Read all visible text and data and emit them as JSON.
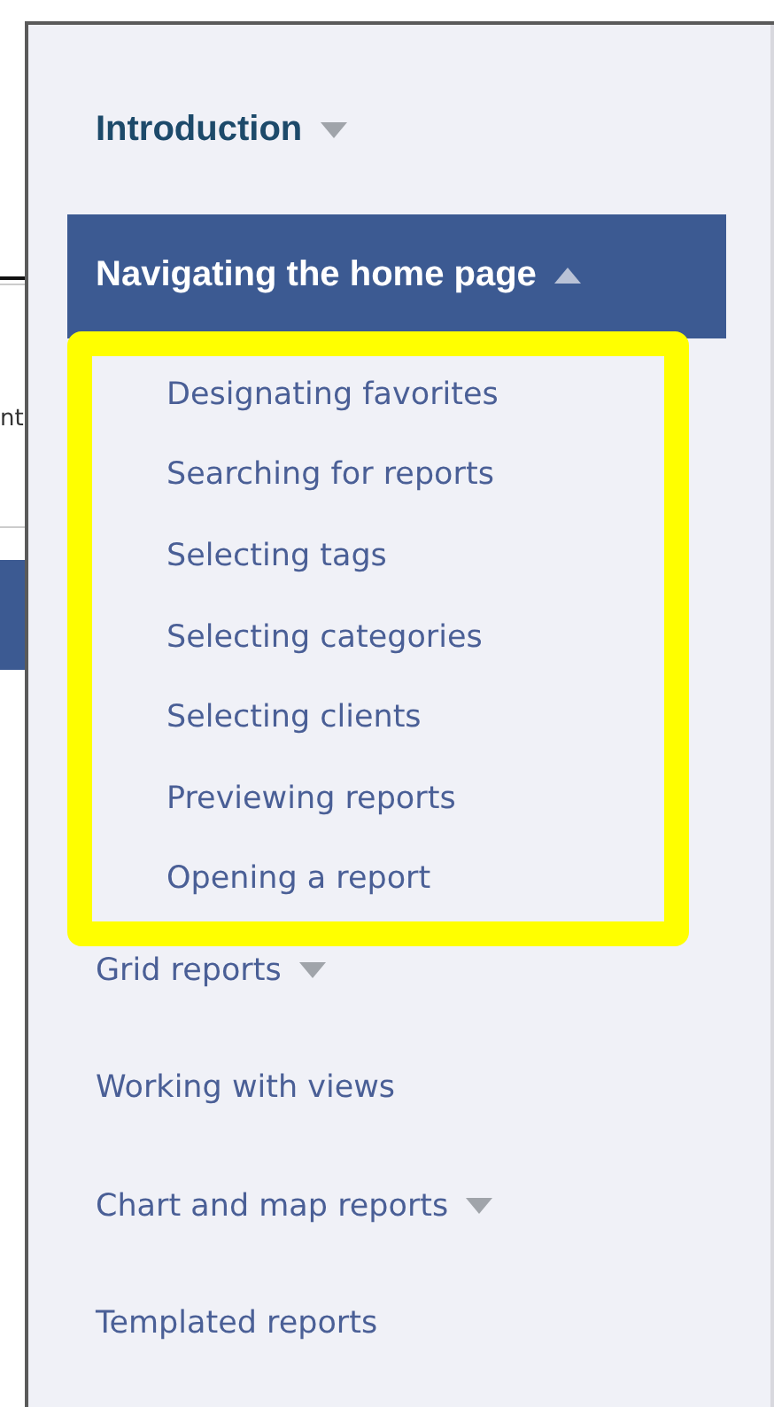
{
  "background_page": {
    "heading_fragment": "nt"
  },
  "toc": [
    {
      "label": "Introduction",
      "kind": "heading",
      "expandable": true,
      "expanded": false,
      "selected": false
    },
    {
      "label": "Navigating the home page",
      "kind": "heading",
      "expandable": true,
      "expanded": true,
      "selected": true,
      "highlighted": true,
      "children": [
        {
          "label": "Designating favorites"
        },
        {
          "label": "Searching for reports"
        },
        {
          "label": "Selecting tags"
        },
        {
          "label": "Selecting categories"
        },
        {
          "label": "Selecting clients"
        },
        {
          "label": "Previewing reports"
        },
        {
          "label": "Opening a report"
        }
      ]
    },
    {
      "label": "Grid reports",
      "kind": "topic",
      "expandable": true,
      "expanded": false,
      "selected": false
    },
    {
      "label": "Working with views",
      "kind": "topic",
      "expandable": false,
      "expanded": false,
      "selected": false
    },
    {
      "label": "Chart and map reports",
      "kind": "topic",
      "expandable": true,
      "expanded": false,
      "selected": false
    },
    {
      "label": "Templated reports",
      "kind": "topic",
      "expandable": false,
      "expanded": false,
      "selected": false
    }
  ]
}
